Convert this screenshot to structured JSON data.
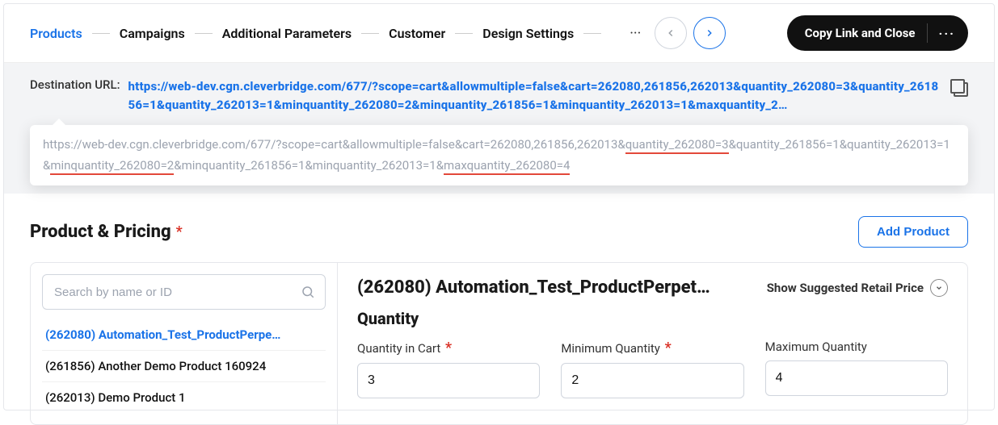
{
  "tabs": {
    "items": [
      "Products",
      "Campaigns",
      "Additional Parameters",
      "Customer",
      "Design Settings"
    ],
    "active_index": 0
  },
  "header": {
    "copy_close_label": "Copy Link and Close"
  },
  "destination": {
    "label": "Destination URL:",
    "url": "https://web-dev.cgn.cleverbridge.com/677/?scope=cart&allowmultiple=false&cart=262080,261856,262013&quantity_262080=3&quantity_261856=1&quantity_262013=1&minquantity_262080=2&minquantity_261856=1&minquantity_262013=1&maxquantity_2…",
    "tooltip_parts": {
      "p1": "https://web-dev.cgn.cleverbridge.com/677/?scope=cart&allowmultiple=false&cart=262080,261856,262013&",
      "h1": "quantity_262080=3",
      "p2": "&quantity_261856=1&quantity_262013=1&",
      "h2": "minquantity_262080=2",
      "p3": "&minquantity_261856=1&minquantity_262013=1&",
      "h3": "maxquantity_262080=4"
    }
  },
  "section": {
    "title": "Product & Pricing",
    "add_button": "Add Product"
  },
  "sidebar": {
    "search_placeholder": "Search by name or ID",
    "items": [
      "(262080) Automation_Test_ProductPerpe…",
      "(261856) Another Demo Product 160924",
      "(262013) Demo Product 1"
    ],
    "selected_index": 0
  },
  "detail": {
    "title": "(262080) Automation_Test_ProductPerpet…",
    "retail_label": "Show Suggested Retail Price",
    "quantity_title": "Quantity",
    "fields": {
      "qty_label": "Quantity in Cart",
      "qty_value": "3",
      "min_label": "Minimum Quantity",
      "min_value": "2",
      "max_label": "Maximum Quantity",
      "max_value": "4"
    }
  }
}
